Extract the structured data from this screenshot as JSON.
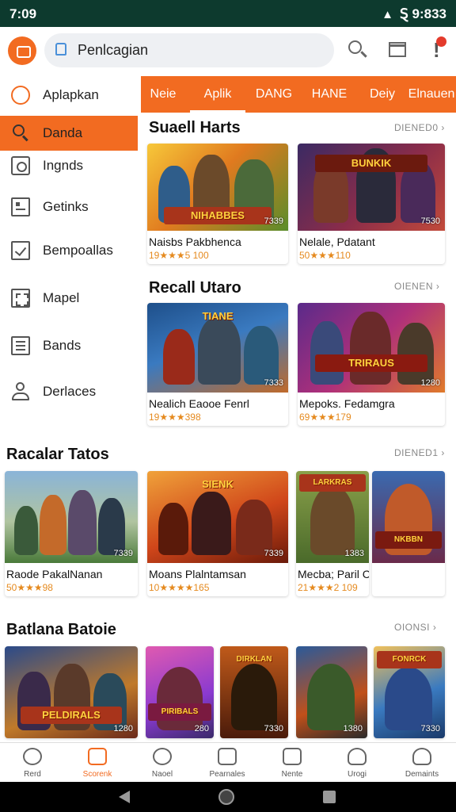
{
  "status": {
    "time": "7:09",
    "right_text": "Ȿ 9:833"
  },
  "search": {
    "placeholder": "Penlcagian"
  },
  "sidebar": {
    "items": [
      {
        "label": "Aplapkan",
        "icon": "compass-icon"
      },
      {
        "label": "Danda",
        "icon": "search-icon",
        "active": true
      },
      {
        "label": "Ingnds",
        "icon": "camera-icon"
      },
      {
        "label": "Getinks",
        "icon": "grid-icon"
      },
      {
        "label": "Bempoallas",
        "icon": "checkbox-icon"
      },
      {
        "label": "Mapel",
        "icon": "map-icon"
      },
      {
        "label": "Bands",
        "icon": "list-icon"
      },
      {
        "label": "Derlaces",
        "icon": "user-icon"
      }
    ]
  },
  "tabs": [
    "Neie",
    "Aplik",
    "DANG",
    "HANE",
    "Deiy",
    "Elnauen"
  ],
  "sections": {
    "s1": {
      "title": "Suaell Harts",
      "see_all": "DIENED0 ›",
      "cards": [
        {
          "name": "Naisbs Pakbhenca",
          "meta": "19★★★5 100",
          "rating": "7339",
          "logo": "NIHABBES"
        },
        {
          "name": "Nelale, Pdatant",
          "meta": "50★★★110",
          "rating": "7530",
          "logo": "BUNKIK"
        }
      ]
    },
    "s2": {
      "title": "Recall Utaro",
      "see_all": "OIENEN ›",
      "cards": [
        {
          "name": "Nealich Eaooe Fenrl",
          "meta": "19★★★398",
          "rating": "7333",
          "logo": "TIANE"
        },
        {
          "name": "Mepoks. Fedamgra",
          "meta": "69★★★179",
          "rating": "1280",
          "logo": "TRIRAUS"
        }
      ]
    },
    "s3": {
      "title": "Racalar Tatos",
      "see_all": "DIENED1 ›",
      "cards": [
        {
          "name": "Raode PakalNanan",
          "meta": "50★★★98",
          "rating": "7339"
        },
        {
          "name": "Moans Plalntamsan",
          "meta": "10★★★★165",
          "rating": "7339",
          "logo": "SIENK"
        },
        {
          "name": "Mecba; Paril Canesah",
          "meta": "21★★★2 109",
          "rating": "1383",
          "logo": "LARKRAS"
        },
        {
          "name": "",
          "meta": "",
          "rating": "",
          "logo": "NKBBN"
        }
      ]
    },
    "s4": {
      "title": "Batlana Batoie",
      "see_all": "OIONSI ›",
      "cards": [
        {
          "rating": "1280",
          "logo": "PELDIRALS"
        },
        {
          "rating": "280",
          "logo": "PIRIBALS"
        },
        {
          "rating": "7330",
          "logo": "DIRKLAN"
        },
        {
          "rating": "1380",
          "logo": ""
        },
        {
          "rating": "7330",
          "logo": "FONRCK"
        }
      ]
    }
  },
  "bottom_nav": [
    {
      "label": "Rerd",
      "icon": "compass-icon"
    },
    {
      "label": "Scorenk",
      "icon": "calendar-icon",
      "active": true
    },
    {
      "label": "Naoel",
      "icon": "controller-icon"
    },
    {
      "label": "Pearnales",
      "icon": "edit-icon"
    },
    {
      "label": "Nente",
      "icon": "note-icon"
    },
    {
      "label": "Urogi",
      "icon": "user-icon"
    },
    {
      "label": "Demaints",
      "icon": "user-icon"
    }
  ],
  "colors": {
    "accent": "#f26b21",
    "statusbar": "#0d3a2e"
  }
}
